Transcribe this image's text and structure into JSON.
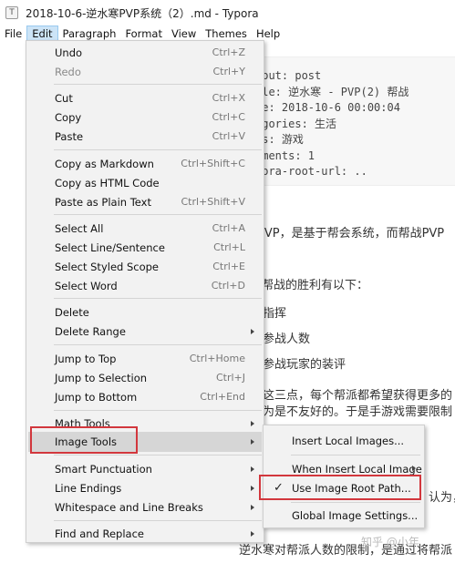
{
  "window": {
    "title": "2018-10-6-逆水寒PVP系统（2）.md - Typora",
    "icon": "T"
  },
  "menubar": [
    "File",
    "Edit",
    "Paragraph",
    "Format",
    "View",
    "Themes",
    "Help"
  ],
  "editor": {
    "front_matter": [
      "yout: post",
      "tle: 逆水寒 - PVP(2) 帮战",
      "te: 2018-10-6 00:00:04",
      "egories: 生活",
      "gs: 游戏",
      "mments: 1",
      "pora-root-url: .."
    ],
    "paragraphs": [
      "PVP，是基于帮会系统，而帮战PVP",
      "帮战的胜利有以下：",
      "指挥",
      "参战人数",
      "参战玩家的装评",
      "这三点，每个帮派都希望获得更多的",
      "为是不友好的。于是手游戏需要限制",
      "认为，",
      "逆水寒对帮派人数的限制，是通过将帮派"
    ],
    "watermark": "知乎 @小年"
  },
  "edit_menu": {
    "items": [
      {
        "label": "Undo",
        "shortcut": "Ctrl+Z"
      },
      {
        "label": "Redo",
        "shortcut": "Ctrl+Y"
      },
      {
        "label": "Cut",
        "shortcut": "Ctrl+X"
      },
      {
        "label": "Copy",
        "shortcut": "Ctrl+C"
      },
      {
        "label": "Paste",
        "shortcut": "Ctrl+V"
      },
      {
        "label": "Copy as Markdown",
        "shortcut": "Ctrl+Shift+C"
      },
      {
        "label": "Copy as HTML Code",
        "shortcut": ""
      },
      {
        "label": "Paste as Plain Text",
        "shortcut": "Ctrl+Shift+V"
      },
      {
        "label": "Select All",
        "shortcut": "Ctrl+A"
      },
      {
        "label": "Select Line/Sentence",
        "shortcut": "Ctrl+L"
      },
      {
        "label": "Select Styled Scope",
        "shortcut": "Ctrl+E"
      },
      {
        "label": "Select Word",
        "shortcut": "Ctrl+D"
      },
      {
        "label": "Delete",
        "shortcut": ""
      },
      {
        "label": "Delete Range",
        "shortcut": ""
      },
      {
        "label": "Jump to Top",
        "shortcut": "Ctrl+Home"
      },
      {
        "label": "Jump to Selection",
        "shortcut": "Ctrl+J"
      },
      {
        "label": "Jump to Bottom",
        "shortcut": "Ctrl+End"
      },
      {
        "label": "Math Tools",
        "shortcut": ""
      },
      {
        "label": "Image Tools",
        "shortcut": ""
      },
      {
        "label": "Smart Punctuation",
        "shortcut": ""
      },
      {
        "label": "Line Endings",
        "shortcut": ""
      },
      {
        "label": "Whitespace and Line Breaks",
        "shortcut": ""
      },
      {
        "label": "Find and Replace",
        "shortcut": ""
      }
    ]
  },
  "image_tools_submenu": {
    "items": [
      {
        "label": "Insert Local Images..."
      },
      {
        "label": "When Insert Local Image"
      },
      {
        "label": "Use Image Root Path...",
        "checked": true
      },
      {
        "label": "Global Image Settings..."
      }
    ]
  },
  "colors": {
    "highlight_box": "#d2373d",
    "menu_bg": "#f2f2f2",
    "hover": "#d6d6d6"
  }
}
